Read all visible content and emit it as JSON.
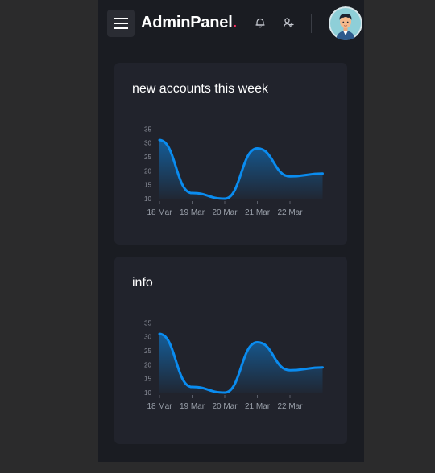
{
  "header": {
    "brand": "AdminPanel",
    "brand_dot": ".",
    "icons": {
      "menu": "hamburger-menu-icon",
      "notifications": "bell-icon",
      "add_user": "user-plus-icon",
      "avatar": "user-avatar"
    }
  },
  "colors": {
    "accent": "#0a8cf0",
    "brand_dot": "#ff2e63",
    "card_background": "#21232c",
    "page_background": "#1a1c22"
  },
  "cards": [
    {
      "title": "new accounts this week",
      "chart_data": {
        "type": "area",
        "categories": [
          "18 Mar",
          "19 Mar",
          "20 Mar",
          "21 Mar",
          "22 Mar"
        ],
        "yticks": [
          10,
          15,
          20,
          25,
          30,
          35
        ],
        "x": [
          0,
          1,
          2,
          3,
          4,
          5
        ],
        "values": [
          31,
          12,
          10,
          28,
          18,
          19
        ],
        "ylim": [
          10,
          35
        ]
      }
    },
    {
      "title": "info",
      "chart_data": {
        "type": "area",
        "categories": [
          "18 Mar",
          "19 Mar",
          "20 Mar",
          "21 Mar",
          "22 Mar"
        ],
        "yticks": [
          10,
          15,
          20,
          25,
          30,
          35
        ],
        "x": [
          0,
          1,
          2,
          3,
          4,
          5
        ],
        "values": [
          31,
          12,
          10,
          28,
          18,
          19
        ],
        "ylim": [
          10,
          35
        ]
      }
    }
  ]
}
